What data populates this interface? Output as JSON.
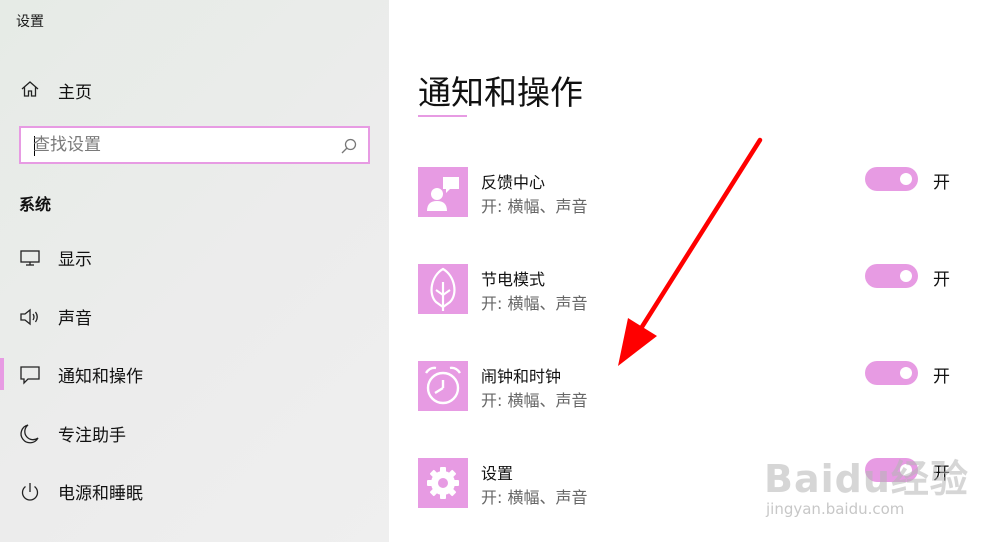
{
  "window": {
    "title": "设置"
  },
  "sidebar": {
    "home_label": "主页",
    "search": {
      "placeholder": "查找设置",
      "value": ""
    },
    "section_title": "系统",
    "items": [
      {
        "label": "显示",
        "icon": "monitor-icon",
        "selected": false
      },
      {
        "label": "声音",
        "icon": "speaker-icon",
        "selected": false
      },
      {
        "label": "通知和操作",
        "icon": "notification-icon",
        "selected": true
      },
      {
        "label": "专注助手",
        "icon": "moon-icon",
        "selected": false
      },
      {
        "label": "电源和睡眠",
        "icon": "power-icon",
        "selected": false
      }
    ]
  },
  "main": {
    "title": "通知和操作",
    "apps": [
      {
        "name": "反馈中心",
        "sub": "开: 横幅、声音",
        "icon": "feedback-hub-icon",
        "toggle_label": "开",
        "on": true
      },
      {
        "name": "节电模式",
        "sub": "开: 横幅、声音",
        "icon": "battery-saver-icon",
        "toggle_label": "开",
        "on": true
      },
      {
        "name": "闹钟和时钟",
        "sub": "开: 横幅、声音",
        "icon": "alarm-clock-icon",
        "toggle_label": "开",
        "on": true
      },
      {
        "name": "设置",
        "sub": "开: 横幅、声音",
        "icon": "gear-icon",
        "toggle_label": "开",
        "on": true
      }
    ]
  },
  "watermark": {
    "brand": "Baidu经验",
    "url": "jingyan.baidu.com"
  },
  "colors": {
    "accent": "#e79be3",
    "arrow": "#ff0000"
  }
}
